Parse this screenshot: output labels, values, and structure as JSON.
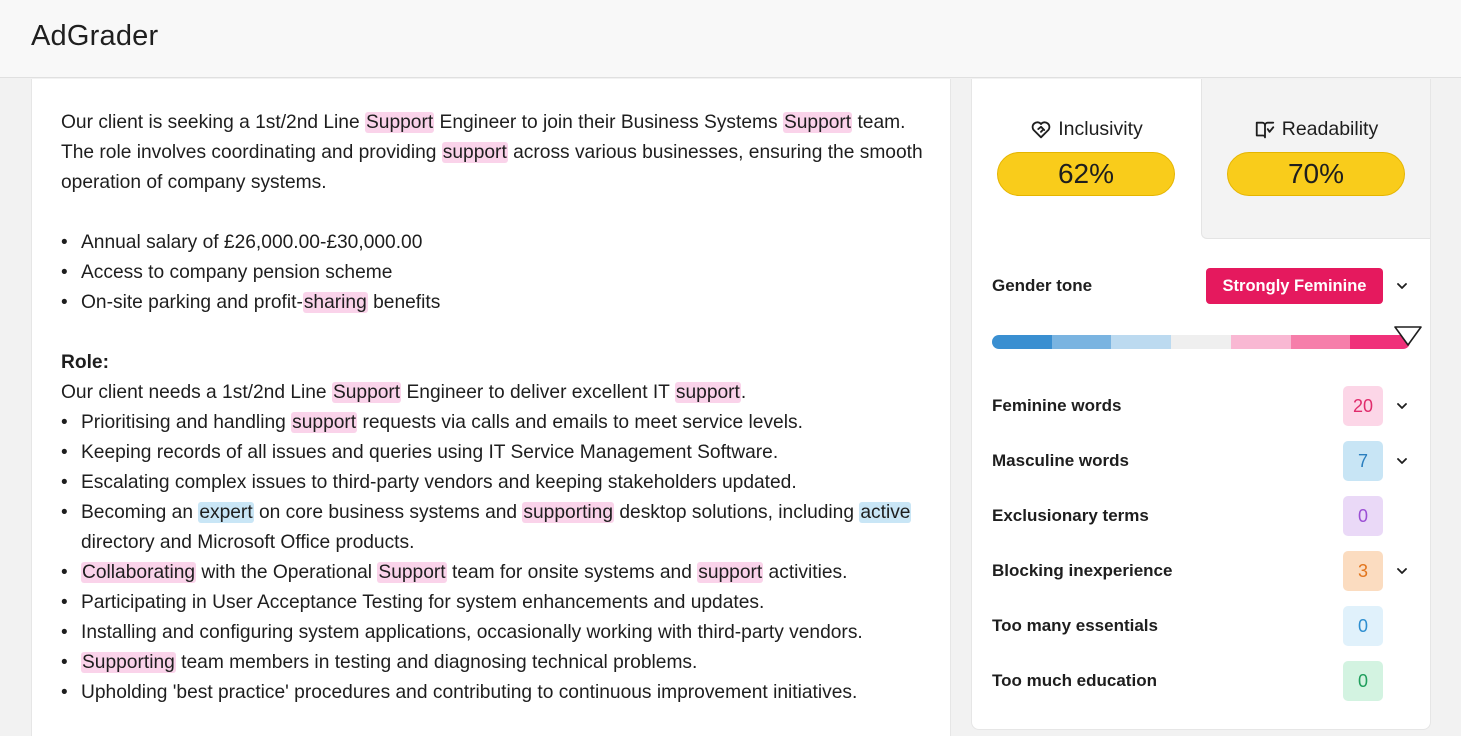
{
  "app": {
    "title": "AdGrader"
  },
  "document": {
    "intro": {
      "p1": "Our client is seeking a 1st/2nd Line ",
      "w1": "Support",
      "p2": " Engineer to join their Business Systems ",
      "w2": "Support",
      "p3": " team. The role involves coordinating and providing ",
      "w3": "support",
      "p4": " across various businesses, ensuring the smooth operation of company systems."
    },
    "benefits": {
      "b1": "Annual salary of £26,000.00-£30,000.00",
      "b2": "Access to company pension scheme",
      "b3_pre": "On-site parking and profit-",
      "b3_word": "sharing",
      "b3_post": " benefits"
    },
    "role": {
      "heading": "Role:",
      "intro_p1": "Our client needs a 1st/2nd Line ",
      "intro_w1": "Support",
      "intro_p2": " Engineer to deliver excellent IT ",
      "intro_w2": "support",
      "intro_p3": ".",
      "r1_pre": "Prioritising and handling ",
      "r1_word": "support",
      "r1_post": " requests via calls and emails to meet service levels.",
      "r2": "Keeping records of all issues and queries using IT Service Management Software.",
      "r3": "Escalating complex issues to third-party vendors and keeping stakeholders updated.",
      "r4_pre": "Becoming an ",
      "r4_w1": "expert",
      "r4_mid": " on core business systems and ",
      "r4_w2": "supporting",
      "r4_mid2": " desktop solutions, including ",
      "r4_w3": "active",
      "r4_post": " directory and Microsoft Office products.",
      "r5_w1": "Collaborating",
      "r5_mid": " with the Operational ",
      "r5_w2": "Support",
      "r5_mid2": " team for onsite systems and ",
      "r5_w3": "support",
      "r5_post": " activities.",
      "r6": "Participating in User Acceptance Testing for system enhancements and updates.",
      "r7": "Installing and configuring system applications, occasionally working with third-party vendors.",
      "r8_w1": "Supporting",
      "r8_post": " team members in testing and diagnosing technical problems.",
      "r9": "Upholding 'best practice' procedures and contributing to continuous improvement initiatives."
    }
  },
  "scores": {
    "inclusivity": {
      "label": "Inclusivity",
      "value": "62%",
      "icon": "heart-handshake-icon"
    },
    "readability": {
      "label": "Readability",
      "value": "70%",
      "icon": "open-book-icon"
    }
  },
  "gender_tone": {
    "label": "Gender tone",
    "value": "Strongly Feminine",
    "scale_colors": [
      "#3a8fd1",
      "#7ab4e1",
      "#bcdaf0",
      "#efefef",
      "#f9b8d3",
      "#f67eaa",
      "#f0317a"
    ],
    "position_fraction": 1.0
  },
  "metrics": [
    {
      "label": "Feminine words",
      "count": "20",
      "bg": "#fcd6e7",
      "fg": "#e02c6c",
      "expandable": true
    },
    {
      "label": "Masculine words",
      "count": "7",
      "bg": "#c8e5f5",
      "fg": "#2b7fbf",
      "expandable": true
    },
    {
      "label": "Exclusionary terms",
      "count": "0",
      "bg": "#ead9f7",
      "fg": "#9b4fd4",
      "expandable": false
    },
    {
      "label": "Blocking inexperience",
      "count": "3",
      "bg": "#fbdcc0",
      "fg": "#e2751d",
      "expandable": true
    },
    {
      "label": "Too many essentials",
      "count": "0",
      "bg": "#e0f1fb",
      "fg": "#2e8fd0",
      "expandable": false
    },
    {
      "label": "Too much education",
      "count": "0",
      "bg": "#d3f3e1",
      "fg": "#1f9e5c",
      "expandable": false
    }
  ]
}
